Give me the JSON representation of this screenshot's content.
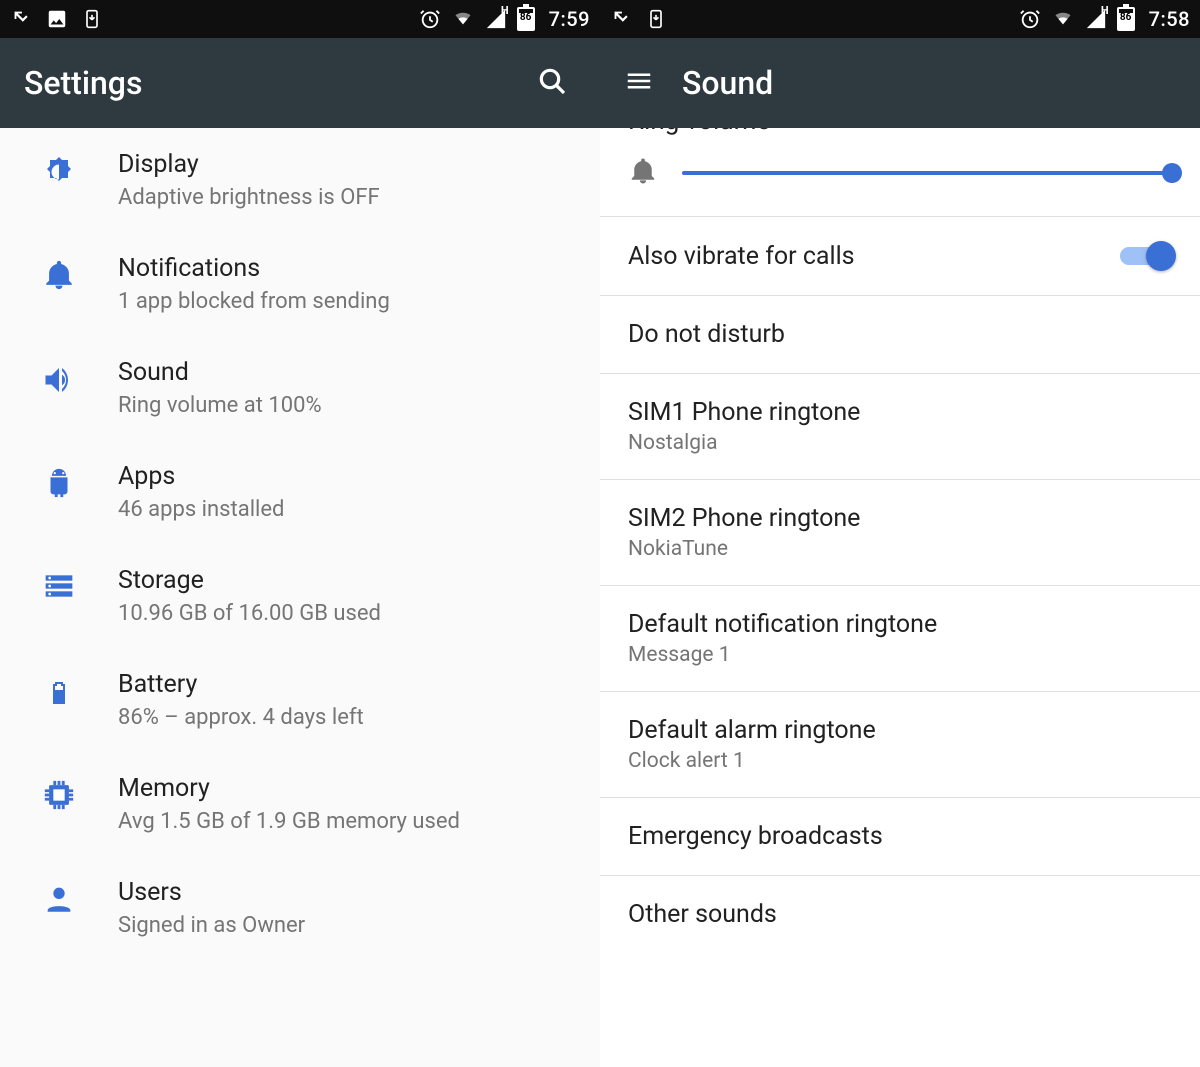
{
  "left": {
    "statusbar": {
      "time": "7:59",
      "battery_pct": "86"
    },
    "appbar": {
      "title": "Settings"
    },
    "items": [
      {
        "icon": "brightness-icon",
        "title": "Display",
        "sub": "Adaptive brightness is OFF"
      },
      {
        "icon": "bell-icon",
        "title": "Notifications",
        "sub": "1 app blocked from sending"
      },
      {
        "icon": "volume-icon",
        "title": "Sound",
        "sub": "Ring volume at 100%"
      },
      {
        "icon": "android-icon",
        "title": "Apps",
        "sub": "46 apps installed"
      },
      {
        "icon": "storage-icon",
        "title": "Storage",
        "sub": "10.96 GB of 16.00 GB used"
      },
      {
        "icon": "battery-icon",
        "title": "Battery",
        "sub": "86% – approx. 4 days left"
      },
      {
        "icon": "memory-icon",
        "title": "Memory",
        "sub": "Avg 1.5 GB of 1.9 GB memory used"
      },
      {
        "icon": "person-icon",
        "title": "Users",
        "sub": "Signed in as Owner"
      }
    ]
  },
  "right": {
    "statusbar": {
      "time": "7:58",
      "battery_pct": "86"
    },
    "appbar": {
      "title": "Sound"
    },
    "ring_volume_label": "Ring volume",
    "ring_volume_percent": 100,
    "items": [
      {
        "title": "Also vibrate for calls",
        "sub": "",
        "switch": true
      },
      {
        "title": "Do not disturb",
        "sub": ""
      },
      {
        "title": "SIM1 Phone ringtone",
        "sub": "Nostalgia"
      },
      {
        "title": "SIM2 Phone ringtone",
        "sub": "NokiaTune"
      },
      {
        "title": "Default notification ringtone",
        "sub": "Message 1"
      },
      {
        "title": "Default alarm ringtone",
        "sub": "Clock alert 1"
      },
      {
        "title": "Emergency broadcasts",
        "sub": ""
      },
      {
        "title": "Other sounds",
        "sub": ""
      }
    ]
  }
}
